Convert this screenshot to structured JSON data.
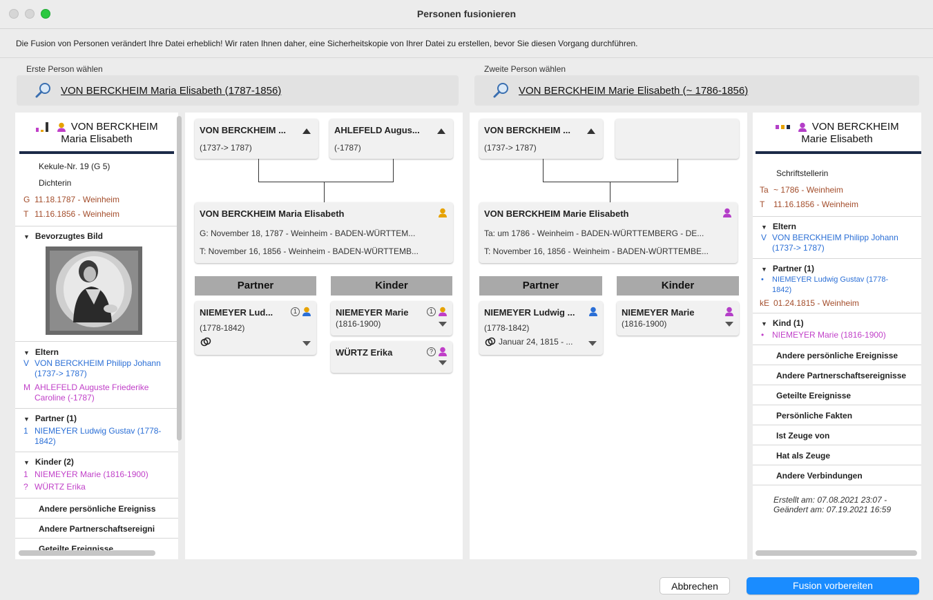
{
  "window": {
    "title": "Personen fusionieren"
  },
  "warning": "Die Fusion von Personen verändert Ihre Datei erheblich! Wir raten Ihnen daher, eine Sicherheitskopie von Ihrer Datei zu erstellen, bevor Sie diesen Vorgang durchführen.",
  "first": {
    "chooser_label": "Erste Person wählen",
    "chooser_name": "VON BERCKHEIM Maria Elisabeth (1787-1856)",
    "side": {
      "name1": "VON BERCKHEIM",
      "name2": "Maria Elisabeth",
      "kekule": "Kekule-Nr. 19 (G 5)",
      "occupation": "Dichterin",
      "birth_prefix": "G",
      "birth": "11.18.1787 - Weinheim",
      "death_prefix": "T",
      "death": "11.16.1856 - Weinheim",
      "preferred_image_header": "Bevorzugtes Bild",
      "parents_header": "Eltern",
      "father_prefix": "V",
      "father": "VON BERCKHEIM Philipp Johann (1737-> 1787)",
      "mother_prefix": "M",
      "mother": "AHLEFELD Auguste Friederike Caroline (-1787)",
      "partner_header": "Partner (1)",
      "partner_prefix": "1",
      "partner": "NIEMEYER Ludwig Gustav (1778-1842)",
      "children_header": "Kinder (2)",
      "child1_prefix": "1",
      "child1": "NIEMEYER Marie (1816-1900)",
      "child2_prefix": "?",
      "child2": "WÜRTZ Erika",
      "other_events": "Andere persönliche Ereigniss",
      "other_partner_events": "Andere Partnerschaftsereigni",
      "shared_events": "Geteilte Ereignisse"
    },
    "tree": {
      "father_name": "VON BERCKHEIM ...",
      "father_dates": "(1737-> 1787)",
      "mother_name": "AHLEFELD Augus...",
      "mother_dates": "(-1787)",
      "person_name": "VON BERCKHEIM Maria Elisabeth",
      "person_birth": "G: November 18, 1787 - Weinheim - BADEN-WÜRTTEM...",
      "person_death": "T: November 16, 1856 - Weinheim - BADEN-WÜRTTEMB...",
      "partner_header": "Partner",
      "children_header": "Kinder",
      "partner_name": "NIEMEYER Lud...",
      "partner_badge": "1",
      "partner_dates": "(1778-1842)",
      "child1_name": "NIEMEYER Marie",
      "child1_badge": "1",
      "child1_dates": "(1816-1900)",
      "child2_name": "WÜRTZ Erika",
      "child2_badge": "?"
    }
  },
  "second": {
    "chooser_label": "Zweite Person wählen",
    "chooser_name": "VON BERCKHEIM Marie Elisabeth (~ 1786-1856)",
    "tree": {
      "father_name": "VON BERCKHEIM ...",
      "father_dates": "(1737-> 1787)",
      "person_name": "VON BERCKHEIM Marie Elisabeth",
      "person_birth": "Ta: um 1786 - Weinheim - BADEN-WÜRTTEMBERG - DE...",
      "person_death": "T: November 16, 1856 - Weinheim - BADEN-WÜRTTEMBE...",
      "partner_header": "Partner",
      "children_header": "Kinder",
      "partner_name": "NIEMEYER Ludwig ...",
      "partner_dates": "(1778-1842)",
      "marriage": "Januar 24, 1815 - ...",
      "child1_name": "NIEMEYER Marie",
      "child1_dates": "(1816-1900)"
    },
    "side": {
      "name1": "VON BERCKHEIM",
      "name2": "Marie Elisabeth",
      "occupation": "Schriftstellerin",
      "birth_prefix": "Ta",
      "birth": "~ 1786 - Weinheim",
      "death_prefix": "T",
      "death": "11.16.1856 - Weinheim",
      "parents_header": "Eltern",
      "father_prefix": "V",
      "father": "VON BERCKHEIM Philipp Johann (1737-> 1787)",
      "partner_header": "Partner (1)",
      "partner_prefix": "•",
      "partner": "NIEMEYER Ludwig Gustav (1778-1842)",
      "marriage_prefix": "kE",
      "marriage": "01.24.1815 - Weinheim",
      "child_header": "Kind (1)",
      "child_prefix": "•",
      "child": "NIEMEYER Marie (1816-1900)",
      "sections": [
        "Andere persönliche Ereignisse",
        "Andere Partnerschaftsereignisse",
        "Geteilte Ereignisse",
        "Persönliche Fakten",
        "Ist Zeuge von",
        "Hat als Zeuge",
        "Andere Verbindungen"
      ],
      "created": "Erstellt am: 07.08.2021 23:07 -",
      "modified": "Geändert am: 07.19.2021 16:59"
    }
  },
  "buttons": {
    "cancel": "Abbrechen",
    "primary": "Fusion vorbereiten"
  },
  "colors": {
    "accent": "#1a8cff",
    "female": "#b43fc8",
    "male": "#2b6fd6",
    "unknown": "#e6a200",
    "rule": "#1c2a48"
  }
}
